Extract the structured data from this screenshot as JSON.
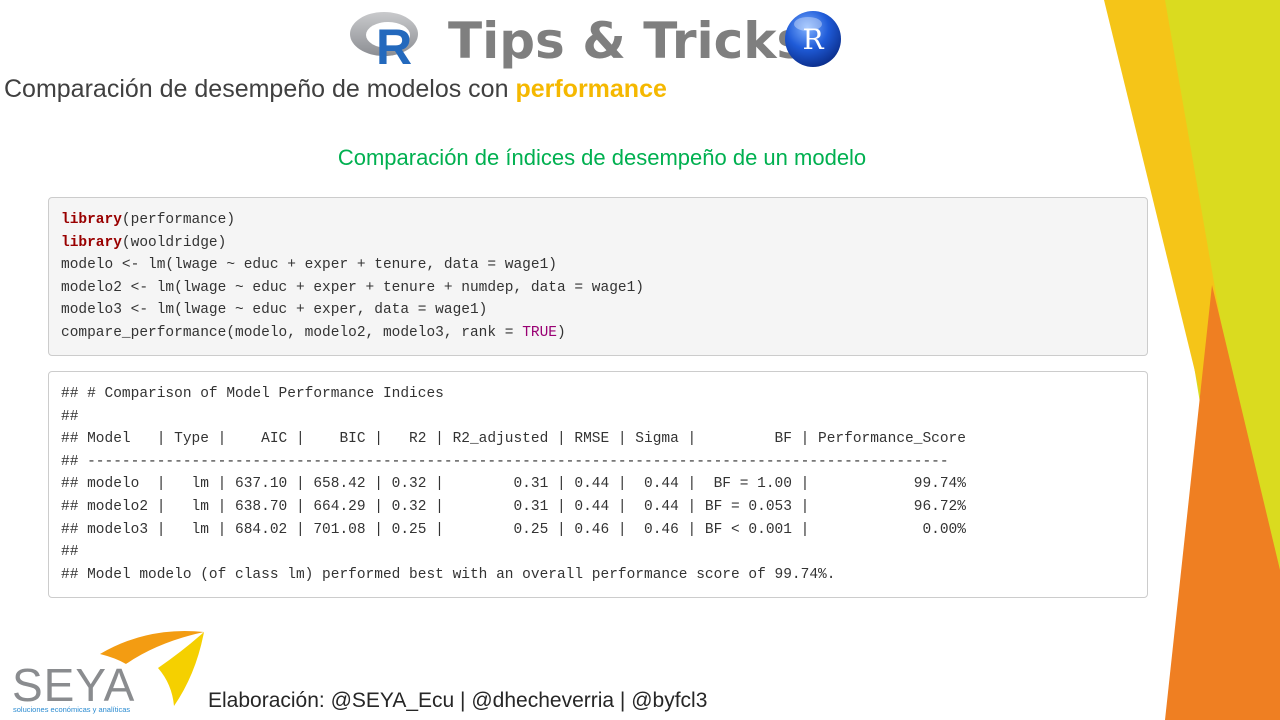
{
  "header": {
    "title": "Tips & Tricks",
    "r_letter": "R",
    "r_ball_letter": "R"
  },
  "subtitle": {
    "prefix": "Comparación de desempeño de modelos con ",
    "highlight": "performance"
  },
  "section_heading": "Comparación de índices de desempeño de un modelo",
  "code": {
    "line1": {
      "fn": "library",
      "rest": "(performance)"
    },
    "line2": {
      "fn": "library",
      "rest": "(wooldridge)"
    },
    "line3": "modelo <- lm(lwage ~ educ + exper + tenure, data = wage1)",
    "line4": "modelo2 <- lm(lwage ~ educ + exper + tenure + numdep, data = wage1)",
    "line5": "modelo3 <- lm(lwage ~ educ + exper, data = wage1)",
    "line6": {
      "pre": "compare_performance(modelo, modelo2, modelo3, rank = ",
      "true": "TRUE",
      "post": ")"
    }
  },
  "output": {
    "lines": [
      "## # Comparison of Model Performance Indices",
      "##",
      "## Model   | Type |    AIC |    BIC |   R2 | R2_adjusted | RMSE | Sigma |         BF | Performance_Score",
      "## ---------------------------------------------------------------------------------------------------",
      "## modelo  |   lm | 637.10 | 658.42 | 0.32 |        0.31 | 0.44 |  0.44 |  BF = 1.00 |            99.74%",
      "## modelo2 |   lm | 638.70 | 664.29 | 0.32 |        0.31 | 0.44 |  0.44 | BF = 0.053 |            96.72%",
      "## modelo3 |   lm | 684.02 | 701.08 | 0.25 |        0.25 | 0.46 |  0.46 | BF < 0.001 |             0.00%",
      "##",
      "## Model modelo (of class lm) performed best with an overall performance score of 99.74%."
    ]
  },
  "footer": {
    "logo_text": "SEYA",
    "logo_tagline": "soluciones económicas y analíticas",
    "credits": "Elaboración: @SEYA_Ecu | @dhecheverria | @byfcl3"
  },
  "colors": {
    "yellow": "#f5c518",
    "lime": "#dadb1f",
    "orange": "#ef7f22",
    "green_heading": "#00b050",
    "highlight": "#f5b800"
  }
}
